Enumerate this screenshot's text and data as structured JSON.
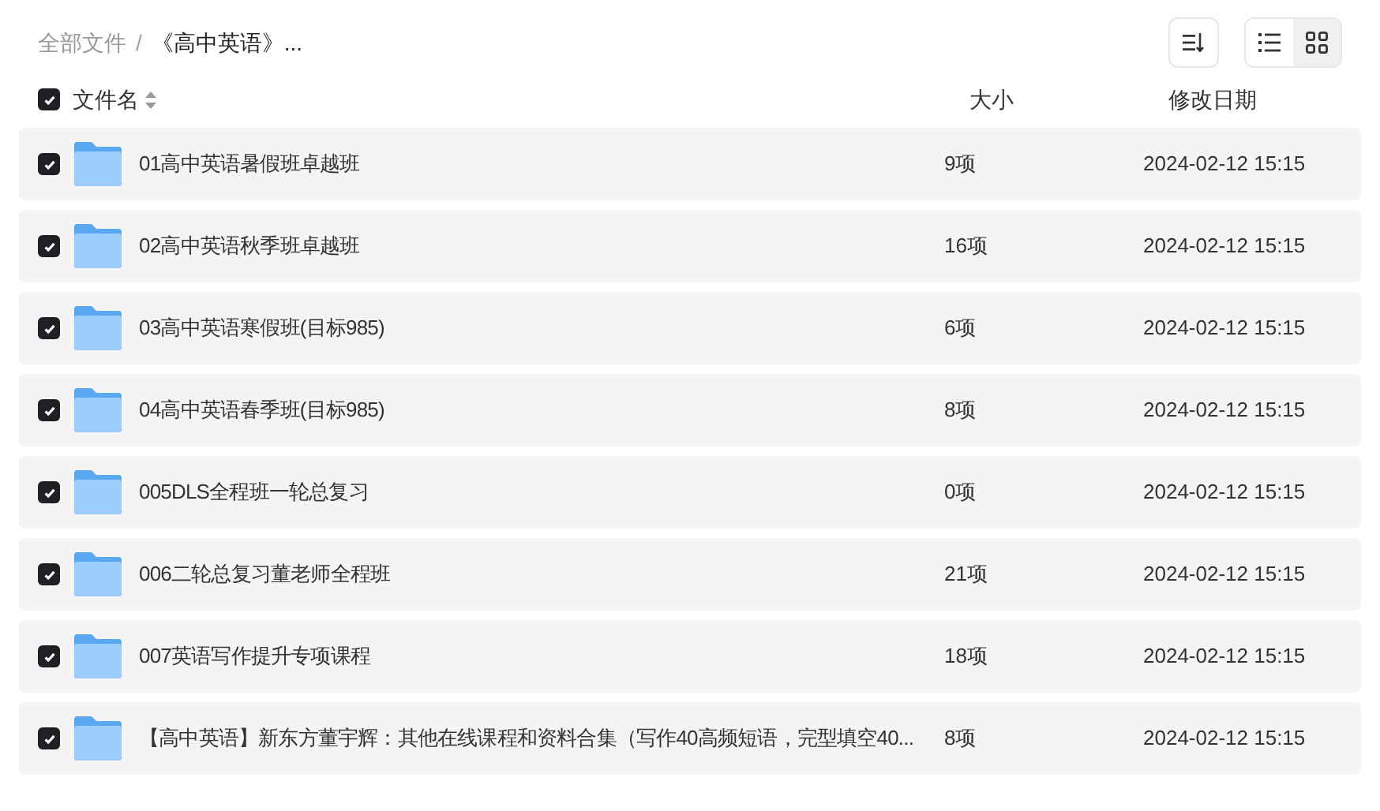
{
  "breadcrumb_separator": "/",
  "breadcrumb": [
    {
      "label": "全部文件",
      "current": false
    },
    {
      "label": "《高中英语》...",
      "current": true
    }
  ],
  "toolbar": {
    "view_modes": [
      {
        "kind": "list",
        "selected": false
      },
      {
        "kind": "grid",
        "selected": true
      }
    ]
  },
  "header": {
    "checked": true,
    "columns": [
      "文件名",
      "大小",
      "修改日期"
    ]
  },
  "rows": [
    {
      "name": "01高中英语暑假班卓越班",
      "size": "9项",
      "modified": "2024-02-12 15:15",
      "checked": true
    },
    {
      "name": "02高中英语秋季班卓越班",
      "size": "16项",
      "modified": "2024-02-12 15:15",
      "checked": true
    },
    {
      "name": "03高中英语寒假班(目标985)",
      "size": "6项",
      "modified": "2024-02-12 15:15",
      "checked": true
    },
    {
      "name": "04高中英语春季班(目标985)",
      "size": "8项",
      "modified": "2024-02-12 15:15",
      "checked": true
    },
    {
      "name": "005DLS全程班一轮总复习",
      "size": "0项",
      "modified": "2024-02-12 15:15",
      "checked": true
    },
    {
      "name": "006二轮总复习董老师全程班",
      "size": "21项",
      "modified": "2024-02-12 15:15",
      "checked": true
    },
    {
      "name": "007英语写作提升专项课程",
      "size": "18项",
      "modified": "2024-02-12 15:15",
      "checked": true
    },
    {
      "name": "【高中英语】新东方董宇辉：其他在线课程和资料合集（写作40高频短语，完型填空40...",
      "size": "8项",
      "modified": "2024-02-12 15:15",
      "checked": true
    }
  ]
}
